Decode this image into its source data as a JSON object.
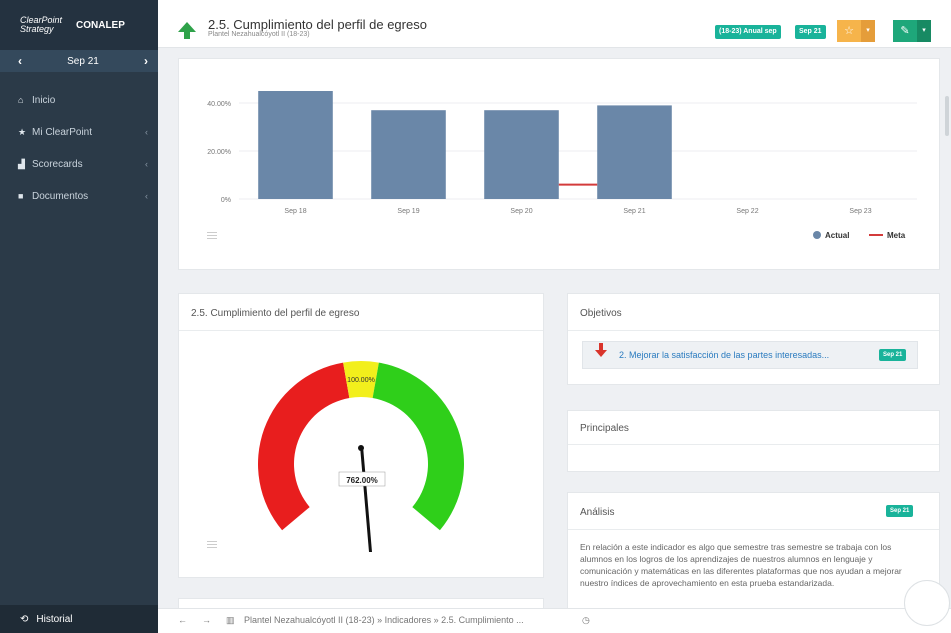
{
  "brand": {
    "logo_text": "ClearPoint Strategy",
    "org": "CONALEP"
  },
  "period_nav": {
    "label": "Sep 21",
    "prev_icon": "chevron-left-icon",
    "next_icon": "chevron-right-icon"
  },
  "nav": {
    "items": [
      {
        "label": "Inicio",
        "icon": "home-icon"
      },
      {
        "label": "Mi ClearPoint",
        "icon": "star-icon"
      },
      {
        "label": "Scorecards",
        "icon": "chart-icon"
      },
      {
        "label": "Documentos",
        "icon": "document-icon"
      }
    ],
    "history": "Historial"
  },
  "header": {
    "title": "2.5. Cumplimiento del perfil de egreso",
    "subtitle": "Plantel Nezahualcóyotl II (18-23)",
    "badge_range": "(18-23) Anual sep",
    "badge_period": "Sep 21"
  },
  "chart_data": {
    "type": "bar",
    "categories": [
      "Sep 18",
      "Sep 19",
      "Sep 20",
      "Sep 21",
      "Sep 22",
      "Sep 23"
    ],
    "series": [
      {
        "name": "Actual",
        "values": [
          45,
          37,
          37,
          39,
          null,
          null
        ],
        "color": "#6a87a8"
      },
      {
        "name": "Meta",
        "type": "line",
        "values": [
          null,
          null,
          6,
          6,
          null,
          null
        ],
        "color": "#d33b3b"
      }
    ],
    "yticks": [
      "0%",
      "20.00%",
      "40.00%"
    ],
    "ylim": [
      0,
      50
    ],
    "legend": "bottom-right"
  },
  "gauge": {
    "title": "2.5. Cumplimiento del perfil de egreso",
    "value_label": "762.00%",
    "top_label": "100.00%",
    "colors": {
      "red": "#e81e1e",
      "yellow": "#f2ef1c",
      "green": "#2fcf1a"
    }
  },
  "objectives": {
    "title": "Objetivos",
    "item": "2. Mejorar la satisfacción de las partes interesadas...",
    "badge": "Sep 21"
  },
  "principales": {
    "title": "Principales"
  },
  "analysis": {
    "title": "Análisis",
    "badge": "Sep 21",
    "text": "En relación a este indicador es algo que semestre tras semestre se trabaja con los alumnos en los logros de los aprendizajes de nuestros alumnos en lenguaje y comunicación y matemáticas en las diferentes plataformas que nos ayudan a mejorar nuestro índices de aprovechamiento en esta prueba estandarizada."
  },
  "bottom_bar": {
    "breadcrumb": "Plantel Nezahualcóyotl II (18-23) » Indicadores » 2.5. Cumplimiento ..."
  }
}
